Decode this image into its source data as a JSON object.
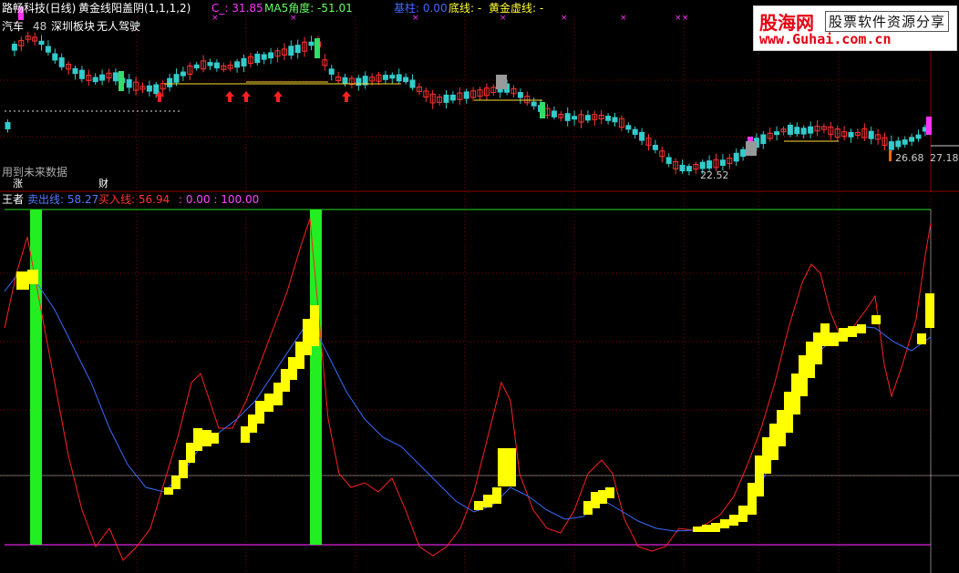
{
  "top_panel": {
    "stock_name": "路畅科技(日线)",
    "indicator_name": "黄金线阳盖阴(1,1,1,2)",
    "c_label": "C_: 31.85",
    "ma5_label": "MA5角度: -51.01",
    "base_label": "基柱: 0.00",
    "bottom_line_label": "底线: -",
    "gold_line_label": "黄金虚线: -",
    "sector_auto": "汽车",
    "sector_count": "48",
    "sector_shenzhen": "深圳板块",
    "sector_autopilot": "无人驾驶",
    "future_data_label": "用到未来数据",
    "price_high": "26.68",
    "price_right": "27.18",
    "price_low": "22.52",
    "tag_zhang": "涨",
    "tag_cai": "财"
  },
  "bottom_panel": {
    "name": "王者",
    "sell_line": "卖出线: 58.27",
    "buy_line": "买入线: 56.94",
    "range_values": ": 0.00 : 100.00"
  },
  "logo": {
    "brand": "股海网",
    "slogan": "股票软件资源分享",
    "url": "www.Guhai.com.cn"
  },
  "colors": {
    "background": "#000000",
    "grid": "#8b0000",
    "up_candle": "#ff3333",
    "down_candle": "#33cccc",
    "buy_line": "#ff2020",
    "sell_line": "#3a6cff",
    "highlight_bar": "#ffff00",
    "signal_bar": "#22ee22",
    "level_line": "#dd22dd"
  }
}
